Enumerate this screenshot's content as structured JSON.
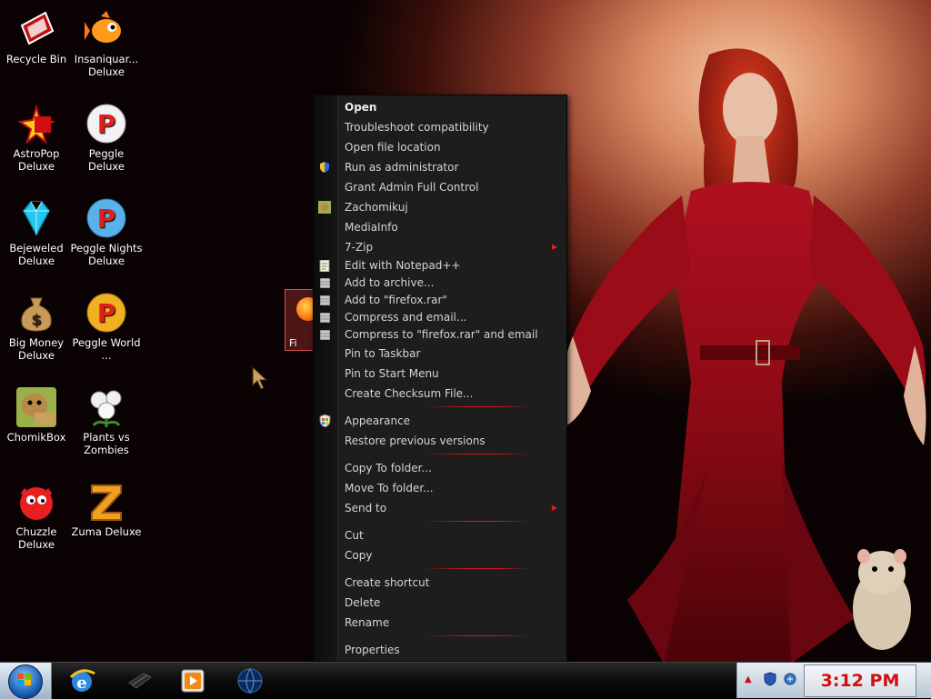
{
  "desktop": {
    "icons": [
      {
        "label": "Recycle Bin",
        "icon": "recycle-bin-icon"
      },
      {
        "label": "Insaniquar... Deluxe",
        "icon": "fish-icon"
      },
      {
        "label": "AstroPop Deluxe",
        "icon": "astropop-icon"
      },
      {
        "label": "Peggle Deluxe",
        "icon": "peggle-icon"
      },
      {
        "label": "Bejeweled Deluxe",
        "icon": "diamond-icon"
      },
      {
        "label": "Peggle Nights Deluxe",
        "icon": "peggle-nights-icon"
      },
      {
        "label": "Big Money Deluxe",
        "icon": "money-bag-icon"
      },
      {
        "label": "Peggle World ...",
        "icon": "peggle-world-icon"
      },
      {
        "label": "ChomikBox",
        "icon": "chomikbox-icon"
      },
      {
        "label": "Plants vs Zombies",
        "icon": "plant-icon"
      },
      {
        "label": "Chuzzle Deluxe",
        "icon": "chuzzle-icon"
      },
      {
        "label": "Zuma Deluxe",
        "icon": "zuma-icon"
      }
    ],
    "selected_icon_label": "Fi"
  },
  "menu": {
    "items": [
      {
        "label": "Open",
        "bold": true
      },
      {
        "label": "Troubleshoot compatibility"
      },
      {
        "label": "Open file location"
      },
      {
        "label": "Run as administrator",
        "icon": "shield-icon"
      },
      {
        "label": "Grant Admin Full Control"
      },
      {
        "label": "Zachomikuj",
        "icon": "chomikbox-icon"
      },
      {
        "label": "MediaInfo"
      },
      {
        "label": "7-Zip",
        "submenu": true
      },
      {
        "label": "Edit with Notepad++",
        "icon": "notepad-icon",
        "tight": true
      },
      {
        "label": "Add to archive...",
        "icon": "archive-icon",
        "tight": true
      },
      {
        "label": "Add to \"firefox.rar\"",
        "icon": "archive-icon",
        "tight": true
      },
      {
        "label": "Compress and email...",
        "icon": "archive-icon",
        "tight": true
      },
      {
        "label": "Compress to \"firefox.rar\" and email",
        "icon": "archive-icon",
        "tight": true
      },
      {
        "label": "Pin to Taskbar"
      },
      {
        "label": "Pin to Start Menu"
      },
      {
        "label": "Create Checksum File..."
      },
      null,
      {
        "label": "Appearance",
        "icon": "windows-shield-icon"
      },
      {
        "label": "Restore previous versions"
      },
      null,
      {
        "label": "Copy To folder..."
      },
      {
        "label": "Move To folder..."
      },
      {
        "label": "Send to",
        "submenu": true
      },
      null,
      {
        "label": "Cut"
      },
      {
        "label": "Copy"
      },
      null,
      {
        "label": "Create shortcut"
      },
      {
        "label": "Delete"
      },
      {
        "label": "Rename"
      },
      null,
      {
        "label": "Properties"
      }
    ]
  },
  "taskbar": {
    "start": "start-orb-icon",
    "pinned": [
      "internet-explorer-icon",
      "media-app-icon",
      "media-player-icon",
      "globe-icon"
    ],
    "clock": "3:12 PM"
  },
  "colors": {
    "accent": "#d01818",
    "menu_bg": "#1d1d1d",
    "menu_text": "#d4d4d4"
  }
}
